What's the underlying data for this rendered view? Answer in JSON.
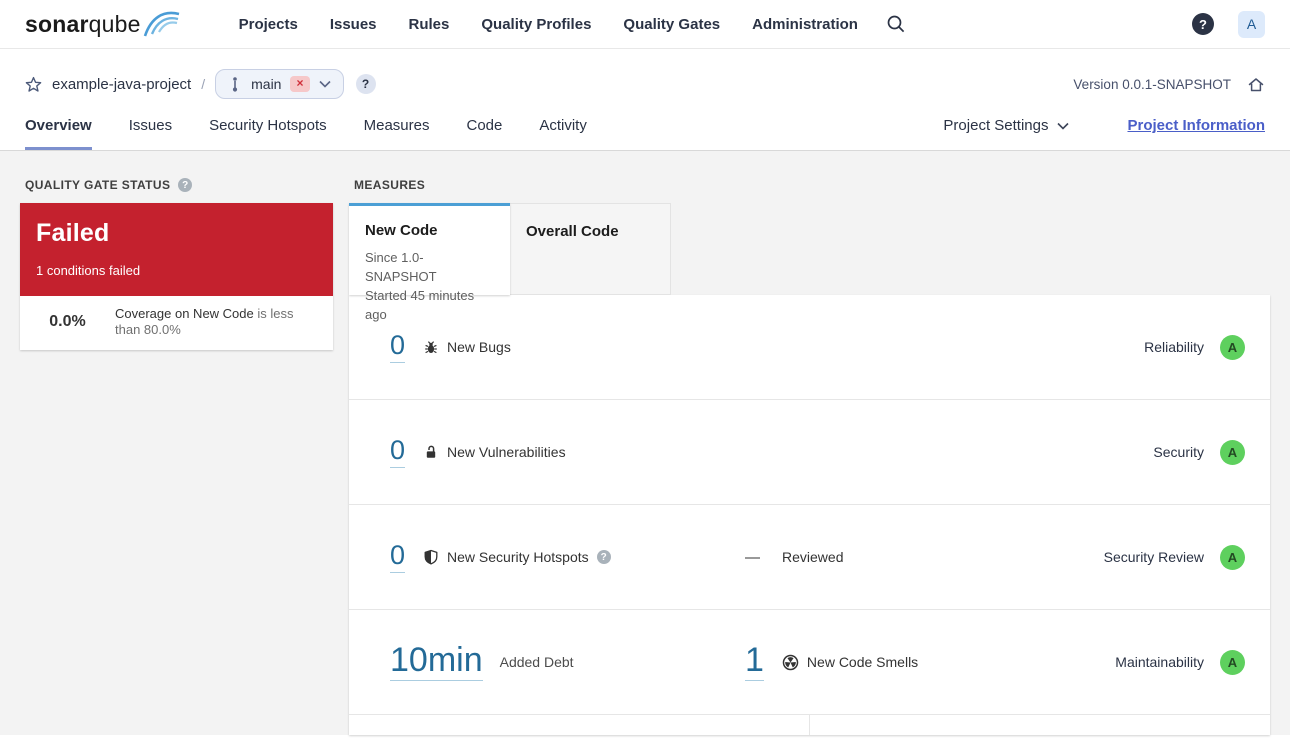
{
  "nav": {
    "brand": {
      "bold": "sonar",
      "light": "qube"
    },
    "items": [
      "Projects",
      "Issues",
      "Rules",
      "Quality Profiles",
      "Quality Gates",
      "Administration"
    ],
    "help_glyph": "?",
    "avatar": "A"
  },
  "breadcrumb": {
    "project": "example-java-project",
    "separator": "/",
    "branch": {
      "name": "main",
      "failed_badge": "×"
    },
    "pill_help_glyph": "?",
    "version_label": "Version 0.0.1-SNAPSHOT"
  },
  "tabs": {
    "items": [
      "Overview",
      "Issues",
      "Security Hotspots",
      "Measures",
      "Code",
      "Activity"
    ],
    "active": "Overview",
    "project_settings": "Project Settings",
    "project_information": "Project Information"
  },
  "quality_gate": {
    "title": "QUALITY GATE STATUS",
    "help_glyph": "?",
    "status": "Failed",
    "conditions_summary": "1 conditions failed",
    "condition": {
      "value": "0.0%",
      "metric": "Coverage on New Code",
      "detail": "is less than 80.0%"
    }
  },
  "measures": {
    "title": "MEASURES",
    "tabs": {
      "new_code": {
        "label": "New Code",
        "line1": "Since 1.0-SNAPSHOT",
        "line2": "Started 45 minutes ago"
      },
      "overall_code": {
        "label": "Overall Code"
      }
    },
    "rows": [
      {
        "value": "0",
        "label": "New Bugs",
        "rating_label": "Reliability",
        "rating": "A"
      },
      {
        "value": "0",
        "label": "New Vulnerabilities",
        "rating_label": "Security",
        "rating": "A"
      },
      {
        "value": "0",
        "label": "New Security Hotspots",
        "help_glyph": "?",
        "secondary_value": "—",
        "secondary_label": "Reviewed",
        "rating_label": "Security Review",
        "rating": "A"
      },
      {
        "value": "10min",
        "label": "Added Debt",
        "secondary_value": "1",
        "secondary_label": "New Code Smells",
        "rating_label": "Maintainability",
        "rating": "A"
      }
    ]
  },
  "colors": {
    "failed_red": "#c4212e",
    "rating_a_green": "#5ed05e",
    "link_blue": "#236a97",
    "new_code_tab_blue": "#4b9fd5",
    "active_tab_underline": "#7d90ce",
    "page_background": "#f3f3f3"
  }
}
